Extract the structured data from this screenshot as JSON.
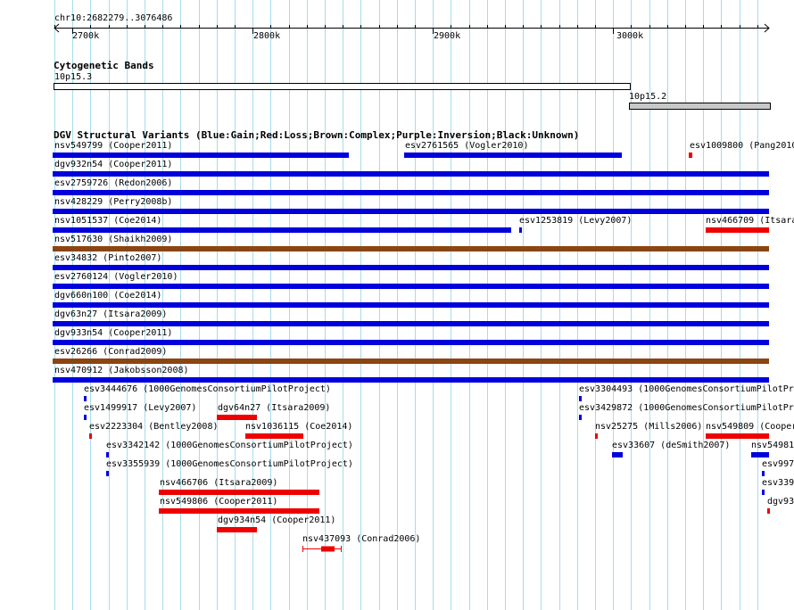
{
  "browser": {
    "locus": "chr10:2682279..3076486",
    "ruler_labels": [
      "2700k",
      "2800k",
      "2900k",
      "3000k"
    ],
    "colors": {
      "gain": "#0000dd",
      "loss": "#ee0000",
      "complex": "#8b4513",
      "gridline": "#a6dcec"
    }
  },
  "tracks": {
    "cyto": {
      "title": "Cytogenetic Bands",
      "bands": [
        {
          "label": "10p15.3",
          "fill": "#ffffff"
        },
        {
          "label": "10p15.2",
          "fill": "#c8c8c8"
        }
      ]
    },
    "dgv": {
      "title": "DGV Structural Variants (Blue:Gain;Red:Loss;Brown:Complex;Purple:Inversion;Black:Unknown)",
      "features": [
        {
          "label": "nsv549799 (Cooper2011)",
          "color": "#0000dd"
        },
        {
          "label": "esv2761565 (Vogler2010)",
          "color": "#0000dd"
        },
        {
          "label": "esv1009800 (Pang2010)",
          "color": "#ee0000"
        },
        {
          "label": "dgv932n54 (Cooper2011)",
          "color": "#0000dd"
        },
        {
          "label": "esv2759726 (Redon2006)",
          "color": "#0000dd"
        },
        {
          "label": "nsv428229 (Perry2008b)",
          "color": "#0000dd"
        },
        {
          "label": "nsv1051537 (Coe2014)",
          "color": "#0000dd"
        },
        {
          "label": "esv1253819 (Levy2007)",
          "color": "#0000dd"
        },
        {
          "label": "nsv466709 (Itsara",
          "color": "#ee0000"
        },
        {
          "label": "nsv517630 (Shaikh2009)",
          "color": "#8b4513"
        },
        {
          "label": "esv34832 (Pinto2007)",
          "color": "#0000dd"
        },
        {
          "label": "esv2760124 (Vogler2010)",
          "color": "#0000dd"
        },
        {
          "label": "dgv660n100 (Coe2014)",
          "color": "#0000dd"
        },
        {
          "label": "dgv63n27 (Itsara2009)",
          "color": "#0000dd"
        },
        {
          "label": "dgv933n54 (Cooper2011)",
          "color": "#0000dd"
        },
        {
          "label": "esv26266 (Conrad2009)",
          "color": "#8b4513"
        },
        {
          "label": "nsv470912 (Jakobsson2008)",
          "color": "#0000dd"
        },
        {
          "label": "esv3444676 (1000GenomesConsortiumPilotProject)",
          "color": "#0000dd"
        },
        {
          "label": "esv3304493 (1000GenomesConsortiumPilotPro",
          "color": "#0000dd"
        },
        {
          "label": "esv1499917 (Levy2007)",
          "color": "#0000dd"
        },
        {
          "label": "dgv64n27 (Itsara2009)",
          "color": "#ee0000"
        },
        {
          "label": "esv3429872 (1000GenomesConsortiumPilotPro",
          "color": "#0000dd"
        },
        {
          "label": "esv2223304 (Bentley2008)",
          "color": "#ee0000"
        },
        {
          "label": "nsv1036115 (Coe2014)",
          "color": "#ee0000"
        },
        {
          "label": "nsv25275 (Mills2006)",
          "color": "#ee0000"
        },
        {
          "label": "nsv549809 (Cooper",
          "color": "#ee0000"
        },
        {
          "label": "esv3342142 (1000GenomesConsortiumPilotProject)",
          "color": "#0000dd"
        },
        {
          "label": "esv33607 (deSmith2007)",
          "color": "#0000dd"
        },
        {
          "label": "nsv54981",
          "color": "#0000dd"
        },
        {
          "label": "esv3355939 (1000GenomesConsortiumPilotProject)",
          "color": "#0000dd"
        },
        {
          "label": "esv997",
          "color": "#0000dd"
        },
        {
          "label": "nsv466706 (Itsara2009)",
          "color": "#ee0000"
        },
        {
          "label": "esv339",
          "color": "#0000dd"
        },
        {
          "label": "nsv549806 (Cooper2011)",
          "color": "#ee0000"
        },
        {
          "label": "dgv93",
          "color": "#ee0000"
        },
        {
          "label": "dgv934n54 (Cooper2011)",
          "color": "#ee0000"
        },
        {
          "label": "nsv437093 (Conrad2006)",
          "color": "#ee0000"
        }
      ]
    }
  }
}
